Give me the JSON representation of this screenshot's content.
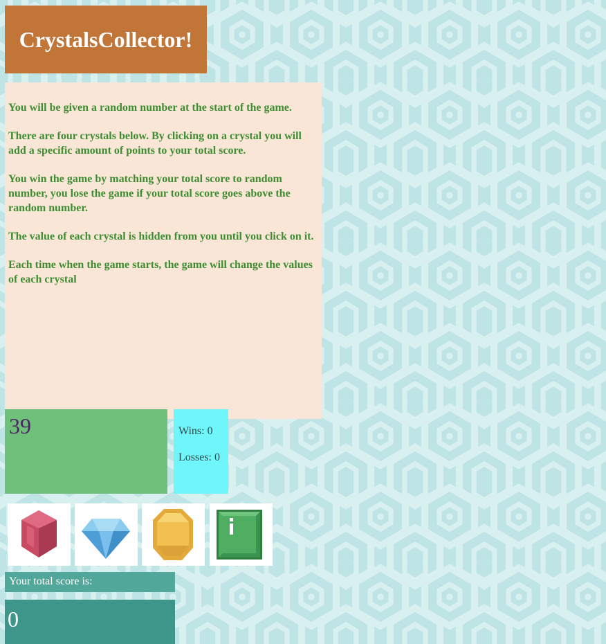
{
  "header": {
    "title": "CrystalsCollector!"
  },
  "instructions": {
    "paragraphs": [
      "You will be given a random number at the start of the game.",
      "There are four crystals below. By clicking on a crystal you will add a specific amount of points to your total score.",
      "You win the game by matching your total score to random number, you lose the game if your total score goes above the random number.",
      "The value of each crystal is hidden from you until you click on it.",
      "Each time when the game starts, the game will change the values of each crystal"
    ]
  },
  "target": {
    "value": "39"
  },
  "stats": {
    "wins": "Wins: 0",
    "losses": "Losses: 0"
  },
  "crystals": [
    {
      "icon": "red-crystal-icon",
      "color": "#c84a63"
    },
    {
      "icon": "blue-diamond-icon",
      "color": "#5aaee6"
    },
    {
      "icon": "yellow-gem-icon",
      "color": "#f2c04e"
    },
    {
      "icon": "green-gem-icon",
      "color": "#4fae61"
    }
  ],
  "score": {
    "label": "Your total score is:",
    "value": "0"
  },
  "colors": {
    "title_bg": "#c17536",
    "instructions_bg": "#fae6d6",
    "instructions_text": "#3e8d33",
    "target_bg": "#6fc07a",
    "stats_bg": "#6ff6fb",
    "score_label_bg": "#52a79b",
    "score_bg": "#3e958a",
    "page_bg": "#bfe4e6"
  }
}
